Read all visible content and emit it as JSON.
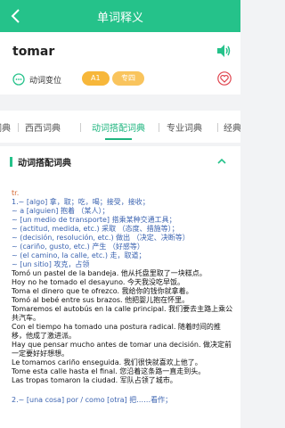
{
  "header": {
    "title": "单词释义"
  },
  "word": {
    "headword": "tomar",
    "conjugation_label": "动词变位",
    "level_badge": "A1",
    "pro_badge": "专四"
  },
  "tabs": [
    {
      "label": "词典"
    },
    {
      "label": "西西词典"
    },
    {
      "label": "动词搭配词典"
    },
    {
      "label": "专业词典"
    },
    {
      "label": "经典"
    }
  ],
  "section": {
    "title": "动词搭配词典"
  },
  "entry": {
    "pos": "tr.",
    "senses": [
      "1.~ [algo] 拿，取；吃，喝；接受，接收；",
      "~ a [alguien] 抱着 （某人）；",
      "~ [un medio de transporte] 搭乘某种交通工具；",
      "~ (actitud, medida, etc.) 采取 （态度、措施等）；",
      "~ (decisión, resolución, etc.) 做出 （决定、决断等）",
      "~ (cariño, gusto, etc.) 产生 （好感等）",
      "~ (el camino, la calle, etc.) 走，取道；",
      "~ [un sitio] 攻克，占领"
    ],
    "examples": [
      "Tomó un pastel de la bandeja. 他从托盘里取了一块糕点。",
      "Hoy no he tomado el desayuno. 今天我没吃早饭。",
      "Toma el dinero que te ofrezco. 我给你的钱你就拿着。",
      "Tomó al bebé entre sus brazos. 他把婴儿抱在怀里。",
      "Tomaremos el autobús en la calle principal. 我们要去主路上乘公共汽车。",
      "Con el tiempo ha tomado una postura radical. 随着时间的推移，他成了激进派。",
      "Hay que pensar mucho antes de tomar una decisión. 做决定前一定要好好想想。",
      "Le tomamos cariño enseguida. 我们很快就喜欢上他了。",
      "Tome esta calle hasta el final. 您沿着这条路一直走到头。",
      "Las tropas tomaron la ciudad. 军队占领了城市。"
    ],
    "next_sense": "2.~ [una cosa] por / como [otra] 把……看作；"
  }
}
